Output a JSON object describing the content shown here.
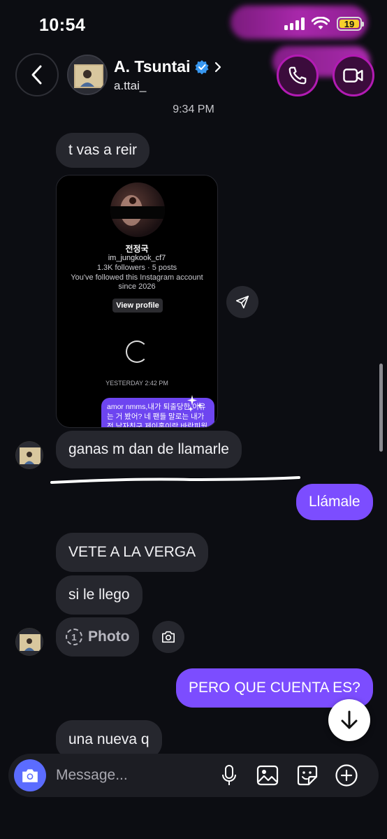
{
  "status_bar": {
    "time": "10:54",
    "battery": "19"
  },
  "header": {
    "name": "A. Tsuntai",
    "username": "a.ttai_",
    "verified": true
  },
  "timestamp": "9:34 PM",
  "shared_profile": {
    "display_name": "전정국",
    "handle": "im_jungkook_cf7",
    "stats": "1.3K followers · 5 posts",
    "follow_note_line1": "You've followed this Instagram account",
    "follow_note_line2": "since 2026",
    "view_profile_label": "View profile",
    "card_timestamp": "YESTERDAY 2:42 PM",
    "card_message": "amor nmms,내가 퇴출당한 이유는 거 봤어? 네 팬들 말로는 내가 전 남자친구 제이홉이랑 바람피웠고"
  },
  "messages": [
    {
      "dir": "in",
      "text": "t vas a reir"
    },
    {
      "dir": "in",
      "text": "ganas m dan de llamarle"
    },
    {
      "dir": "out",
      "text": "Llámale"
    },
    {
      "dir": "in",
      "text": "VETE A LA VERGA"
    },
    {
      "dir": "in",
      "text": "si le llego"
    },
    {
      "dir": "in",
      "text": "Photo",
      "view_once_count": "1"
    },
    {
      "dir": "out",
      "text": "PERO QUE CUENTA ES?"
    },
    {
      "dir": "in",
      "text": "una nueva q"
    }
  ],
  "composer": {
    "placeholder": "Message..."
  },
  "colors": {
    "background": "#0c0d12",
    "incoming_bubble": "#26272e",
    "outgoing_bubble": "#7c4dff",
    "call_accent": "#b21bb3",
    "camera_button": "#5b6cff",
    "verified_badge": "#3897f0"
  },
  "icons": {
    "back": "chevron-left-icon",
    "phone": "phone-icon",
    "video": "video-camera-icon",
    "share": "send-icon",
    "camera": "camera-icon",
    "mic": "microphone-icon",
    "gallery": "image-icon",
    "sticker": "sticker-icon",
    "add": "plus-circle-icon",
    "scroll": "arrow-down-icon"
  }
}
